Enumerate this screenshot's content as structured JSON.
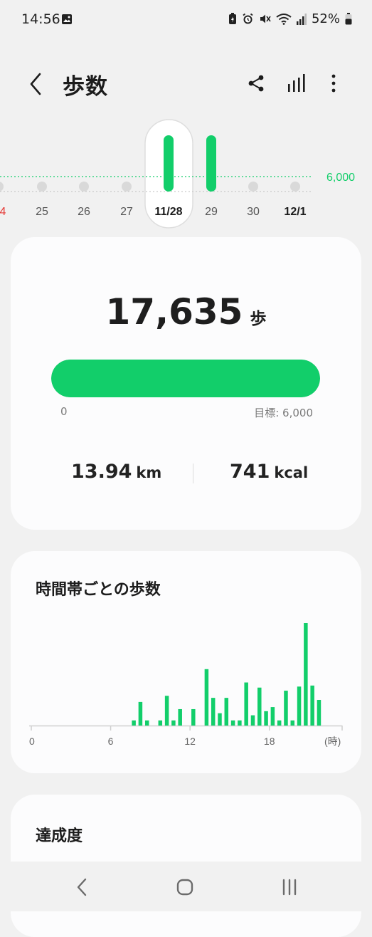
{
  "status_bar": {
    "time": "14:56",
    "battery_percent": "52%",
    "icons": [
      "image-icon",
      "battery-saver-icon",
      "alarm-icon",
      "mute-icon",
      "wifi-icon",
      "signal-icon",
      "battery-icon"
    ]
  },
  "header": {
    "title": "歩数",
    "back_icon": "back-arrow-icon",
    "actions": [
      "share-icon",
      "bar-chart-icon",
      "more-vert-icon"
    ]
  },
  "date_strip": {
    "goal_label": "6,000",
    "days": [
      {
        "label": "4",
        "steps": null,
        "state": "partial-red"
      },
      {
        "label": "25",
        "steps": null,
        "state": "empty"
      },
      {
        "label": "26",
        "steps": null,
        "state": "empty"
      },
      {
        "label": "27",
        "steps": null,
        "state": "empty"
      },
      {
        "label": "11/28",
        "steps": 17635,
        "state": "selected"
      },
      {
        "label": "29",
        "steps": 24000,
        "state": "normal"
      },
      {
        "label": "30",
        "steps": null,
        "state": "empty"
      },
      {
        "label": "12/1",
        "steps": null,
        "state": "today"
      }
    ],
    "colors": {
      "bar": "#12ce6a",
      "goal_line": "#12ce6a",
      "red_date": "#e53935",
      "dot": "#d9d9d9"
    }
  },
  "summary": {
    "steps": "17,635",
    "steps_unit": "歩",
    "progress_fraction": 1.0,
    "progress_min": "0",
    "goal_text": "目標: 6,000",
    "distance_value": "13.94",
    "distance_unit": "km",
    "calories_value": "741",
    "calories_unit": "kcal"
  },
  "hourly": {
    "title": "時間帯ごとの歩数"
  },
  "chart_data": {
    "type": "bar",
    "title": "時間帯ごとの歩数",
    "xlabel": "(時)",
    "ylabel": "",
    "x_ticks": [
      "0",
      "6",
      "12",
      "18",
      "(時)"
    ],
    "xlim": [
      0,
      23.5
    ],
    "ylim": [
      0,
      1
    ],
    "color": "#12ce6a",
    "grid": false,
    "series": [
      {
        "x": [
          7.75,
          8.25,
          8.75,
          9.75,
          10.25,
          10.75,
          11.25,
          12.25,
          13.25,
          13.75,
          14.25,
          14.75,
          15.25,
          15.75,
          16.25,
          16.75,
          17.25,
          17.75,
          18.25,
          18.75,
          19.25,
          19.75,
          20.25,
          20.75,
          21.25,
          21.75
        ],
        "values": [
          0.05,
          0.23,
          0.05,
          0.05,
          0.29,
          0.05,
          0.16,
          0.16,
          0.55,
          0.27,
          0.12,
          0.27,
          0.05,
          0.05,
          0.42,
          0.1,
          0.37,
          0.14,
          0.18,
          0.05,
          0.34,
          0.05,
          0.38,
          1.0,
          0.39,
          0.25
        ]
      }
    ]
  },
  "achievement": {
    "title": "達成度"
  },
  "nav_bar": {
    "buttons": [
      "nav-back-icon",
      "nav-home-icon",
      "nav-recents-icon"
    ]
  }
}
